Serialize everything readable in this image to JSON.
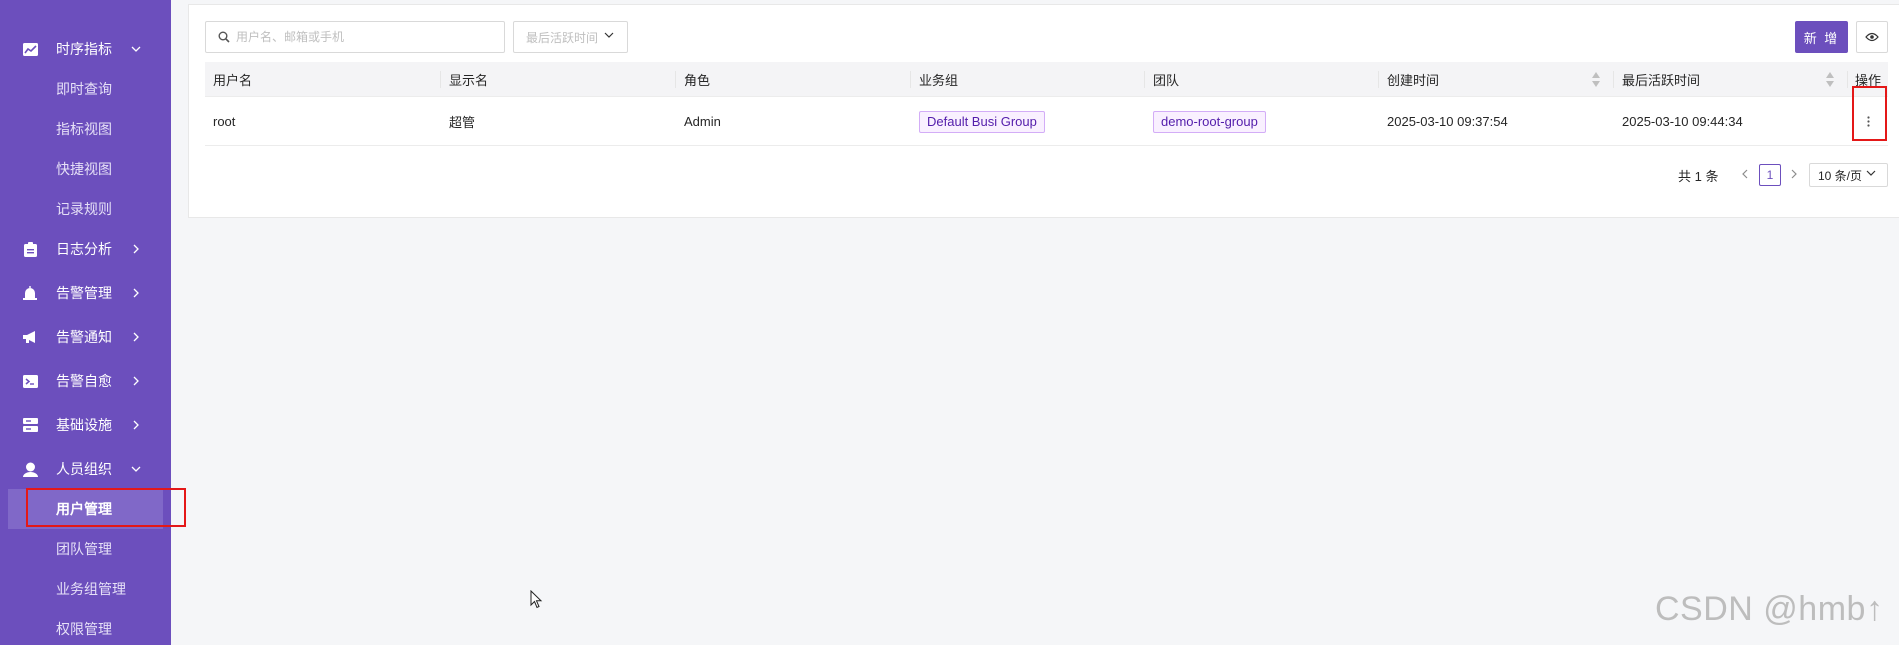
{
  "sidebar": {
    "groups": [
      {
        "label": "时序指标",
        "icon": "chart-line-icon",
        "expanded": true
      },
      {
        "label": "日志分析",
        "icon": "log-file-icon",
        "expanded": false
      },
      {
        "label": "告警管理",
        "icon": "alarm-bell-icon",
        "expanded": false
      },
      {
        "label": "告警通知",
        "icon": "megaphone-icon",
        "expanded": false
      },
      {
        "label": "告警自愈",
        "icon": "terminal-icon",
        "expanded": false
      },
      {
        "label": "基础设施",
        "icon": "server-icon",
        "expanded": false
      },
      {
        "label": "人员组织",
        "icon": "user-icon",
        "expanded": true
      }
    ],
    "metrics_sub": [
      "即时查询",
      "指标视图",
      "快捷视图",
      "记录规则"
    ],
    "org_sub": [
      "用户管理",
      "团队管理",
      "业务组管理",
      "权限管理"
    ],
    "active_item": "用户管理"
  },
  "toolbar": {
    "search_placeholder": "用户名、邮箱或手机",
    "sort_select": "最后活跃时间",
    "new_button": "新 增",
    "eye_icon": "eye-icon"
  },
  "table": {
    "columns": [
      "用户名",
      "显示名",
      "角色",
      "业务组",
      "团队",
      "创建时间",
      "最后活跃时间",
      "操作"
    ],
    "rows": [
      {
        "username": "root",
        "display_name": "超管",
        "role": "Admin",
        "busi_group": "Default Busi Group",
        "team": "demo-root-group",
        "created": "2025-03-10 09:37:54",
        "last_active": "2025-03-10 09:44:34"
      }
    ]
  },
  "pagination": {
    "total": "共 1 条",
    "current": "1",
    "page_size": "10 条/页"
  },
  "watermark": "CSDN @hmb↑",
  "colors": {
    "accent": "#6c4fbd",
    "highlight": "#e41818",
    "tag_bg": "#f9f0ff",
    "tag_text": "#531dab"
  }
}
